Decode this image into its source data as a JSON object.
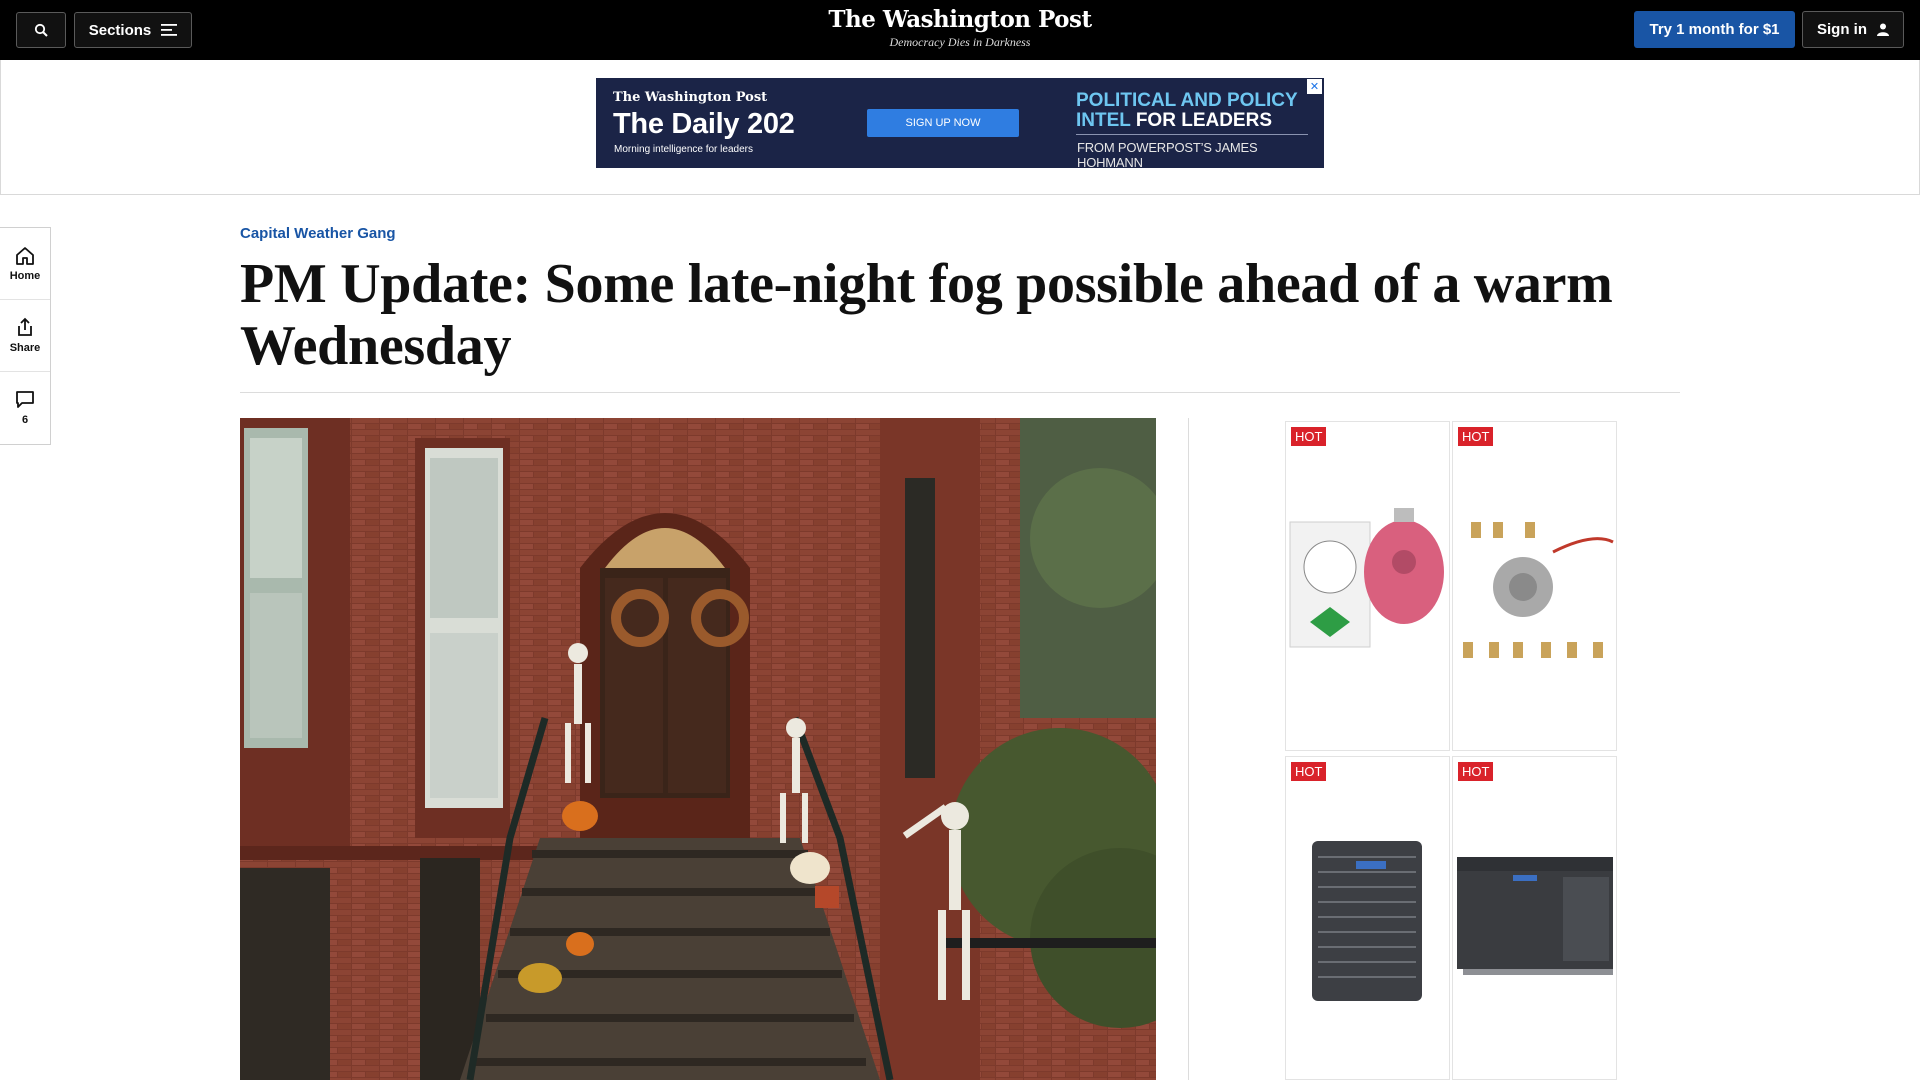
{
  "header": {
    "search_icon": "search-icon",
    "sections_label": "Sections",
    "logo_text": "The Washington Post",
    "tagline": "Democracy Dies in Darkness",
    "subscribe_label": "Try 1 month for $1",
    "signin_label": "Sign in"
  },
  "top_ad": {
    "brand": "The Washington Post",
    "title": "The Daily 202",
    "subtitle": "Morning intelligence for leaders",
    "cta": "SIGN UP NOW",
    "headline_line1": "POLITICAL AND POLICY",
    "headline_line2_accent": "INTEL",
    "headline_line2_rest": " FOR LEADERS",
    "from": "FROM POWERPOST’S JAMES HOHMANN",
    "close_icon": "close-icon"
  },
  "rail": {
    "home_label": "Home",
    "share_label": "Share",
    "comments_count": "6"
  },
  "article": {
    "kicker": "Capital Weather Gang",
    "headline": "PM Update: Some late-night fog possible ahead of a warm Wednesday"
  },
  "side_ads": {
    "badges": [
      "HOT",
      "HOT",
      "HOT",
      "HOT"
    ]
  },
  "colors": {
    "brand_blue": "#1955a5",
    "hot_red": "#d9222a",
    "ad_navy": "#1b2447"
  }
}
